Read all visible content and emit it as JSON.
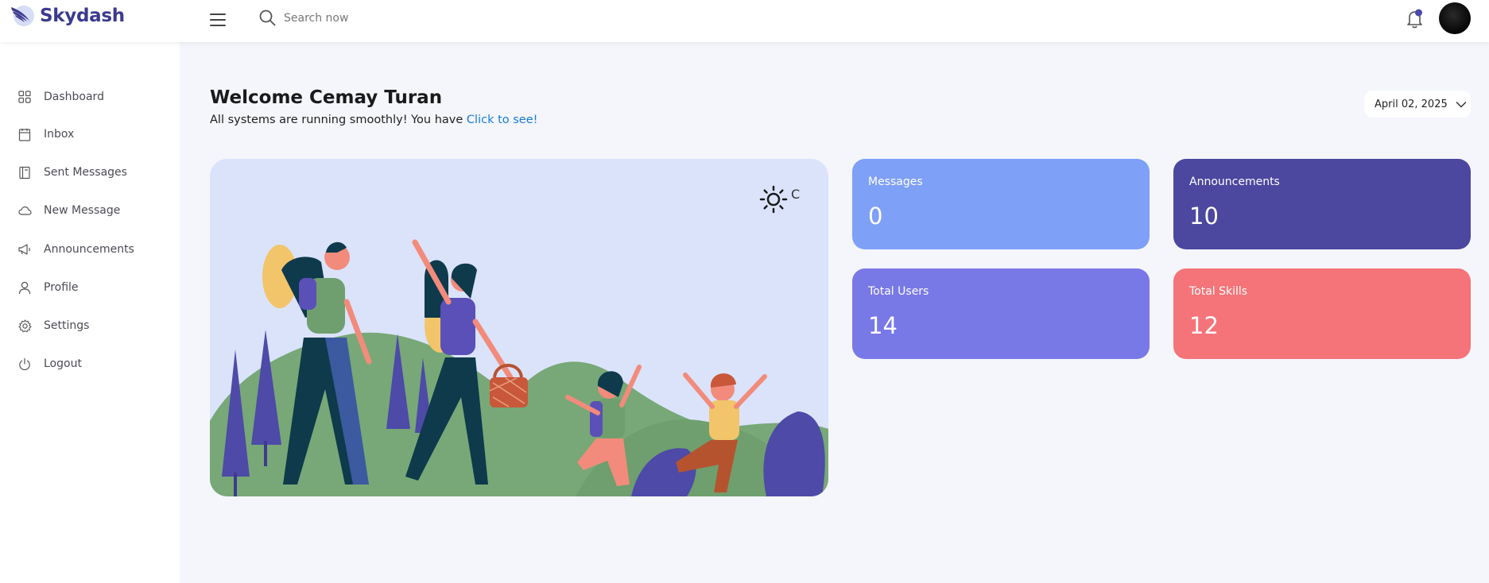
{
  "brand": {
    "name": "Skydash"
  },
  "search": {
    "placeholder": "Search now"
  },
  "sidebar": {
    "items": [
      {
        "label": "Dashboard",
        "icon": "grid-icon"
      },
      {
        "label": "Inbox",
        "icon": "calendar-icon"
      },
      {
        "label": "Sent Messages",
        "icon": "book-icon"
      },
      {
        "label": "New Message",
        "icon": "cloud-icon"
      },
      {
        "label": "Announcements",
        "icon": "megaphone-icon"
      },
      {
        "label": "Profile",
        "icon": "user-icon"
      },
      {
        "label": "Settings",
        "icon": "gear-icon"
      },
      {
        "label": "Logout",
        "icon": "power-icon"
      }
    ]
  },
  "main": {
    "welcome": "Welcome Cemay Turan",
    "subtitle": "All systems are running smoothly! You have ",
    "subtitle_link": "Click to see!",
    "date": "April 02, 2025",
    "weather_unit": "C"
  },
  "cards": [
    {
      "title": "Messages",
      "value": "0",
      "color": "#7ea0f7"
    },
    {
      "title": "Announcements",
      "value": "10",
      "color": "#4c479f"
    },
    {
      "title": "Total Users",
      "value": "14",
      "color": "#7978e7"
    },
    {
      "title": "Total Skills",
      "value": "12",
      "color": "#f47479"
    }
  ],
  "colors": {
    "brand": "#3b3a8f",
    "link": "#1a7bd8",
    "background": "#f4f6fb",
    "notification_dot": "#4b49ac"
  }
}
